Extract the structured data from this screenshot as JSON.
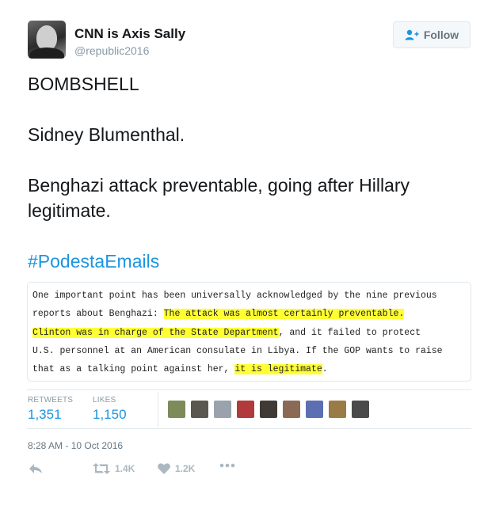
{
  "header": {
    "display_name": "CNN is Axis Sally",
    "handle": "@republic2016",
    "follow_label": "Follow"
  },
  "tweet": {
    "lines": [
      "BOMBSHELL",
      "Sidney Blumenthal.",
      "Benghazi attack preventable, going after Hillary legitimate."
    ],
    "hashtag": "#PodestaEmails"
  },
  "quote": {
    "l1": "One important point has been universally acknowledged by the nine previous",
    "l2a": "reports about Benghazi: ",
    "l2b": "The attack was almost certainly preventable.",
    "l3a": "Clinton was in charge of the State Department",
    "l3b": ", and it failed to protect",
    "l4": "U.S. personnel at an American consulate in Libya. If the GOP wants to raise",
    "l5a": "that as a talking point against her, ",
    "l5b": "it is legitimate",
    "l5c": "."
  },
  "stats": {
    "retweets_label": "RETWEETS",
    "retweets_value": "1,351",
    "likes_label": "LIKES",
    "likes_value": "1,150"
  },
  "likers": [
    {
      "color": "#7d8a5a"
    },
    {
      "color": "#5a5750"
    },
    {
      "color": "#9aa3ad"
    },
    {
      "color": "#b23a3a"
    },
    {
      "color": "#3f3a35"
    },
    {
      "color": "#8a6a55"
    },
    {
      "color": "#5c6fb3"
    },
    {
      "color": "#9a7a45"
    },
    {
      "color": "#4a4a4a"
    }
  ],
  "timestamp": "8:28 AM - 10 Oct 2016",
  "actions": {
    "retweet_count": "1.4K",
    "like_count": "1.2K"
  },
  "colors": {
    "accent": "#1b95e0",
    "highlight": "#ffff33",
    "muted": "#8899a6"
  }
}
